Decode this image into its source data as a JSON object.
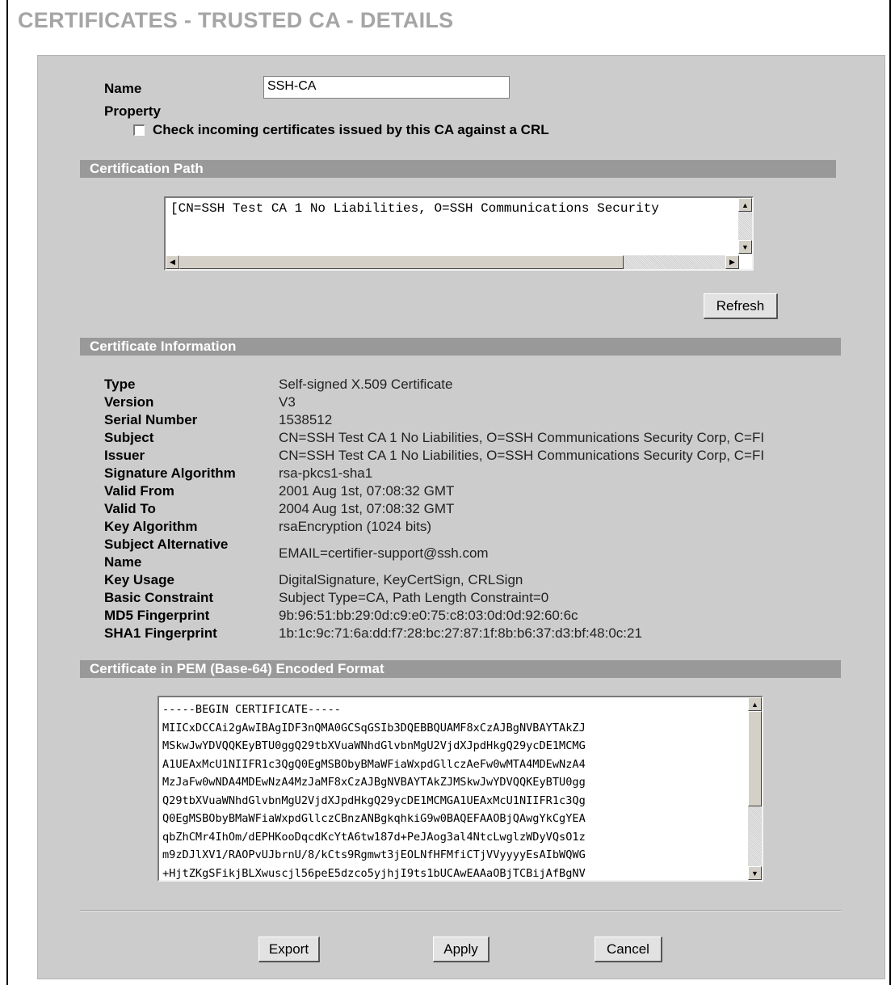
{
  "page_title": "CERTIFICATES - TRUSTED CA - DETAILS",
  "name_label": "Name",
  "name_value": "SSH-CA",
  "property_label": "Property",
  "crl_check_label": "Check incoming certificates issued by this CA against a CRL",
  "crl_checked": false,
  "cert_path": {
    "header": "Certification Path",
    "text": "[CN=SSH Test CA 1 No Liabilities, O=SSH Communications Security",
    "refresh_label": "Refresh"
  },
  "cert_info": {
    "header": "Certificate Information",
    "rows": [
      {
        "key": "Type",
        "value": "Self-signed X.509 Certificate"
      },
      {
        "key": "Version",
        "value": "V3"
      },
      {
        "key": "Serial Number",
        "value": "1538512"
      },
      {
        "key": "Subject",
        "value": "CN=SSH Test CA 1 No Liabilities, O=SSH Communications Security Corp, C=FI"
      },
      {
        "key": "Issuer",
        "value": "CN=SSH Test CA 1 No Liabilities, O=SSH Communications Security Corp, C=FI"
      },
      {
        "key": "Signature Algorithm",
        "value": "rsa-pkcs1-sha1"
      },
      {
        "key": "Valid From",
        "value": "2001 Aug 1st, 07:08:32 GMT"
      },
      {
        "key": "Valid To",
        "value": "2004 Aug 1st, 07:08:32 GMT"
      },
      {
        "key": "Key Algorithm",
        "value": "rsaEncryption (1024 bits)"
      },
      {
        "key": "Subject Alternative Name",
        "value": "EMAIL=certifier-support@ssh.com"
      },
      {
        "key": "Key Usage",
        "value": "DigitalSignature, KeyCertSign, CRLSign"
      },
      {
        "key": "Basic Constraint",
        "value": "Subject Type=CA, Path Length Constraint=0"
      },
      {
        "key": "MD5 Fingerprint",
        "value": "9b:96:51:bb:29:0d:c9:e0:75:c8:03:0d:0d:92:60:6c"
      },
      {
        "key": "SHA1 Fingerprint",
        "value": "1b:1c:9c:71:6a:dd:f7:28:bc:27:87:1f:8b:b6:37:d3:bf:48:0c:21"
      }
    ]
  },
  "pem": {
    "header": "Certificate in PEM (Base-64) Encoded Format",
    "lines": [
      "-----BEGIN CERTIFICATE-----",
      "MIICxDCCAi2gAwIBAgIDF3nQMA0GCSqGSIb3DQEBBQUAMF8xCzAJBgNVBAYTAkZJ",
      "MSkwJwYDVQQKEyBTU0ggQ29tbXVuaWNhdGlvbnMgU2VjdXJpdHkgQ29ycDE1MCMG",
      "A1UEAxMcU1NIIFR1c3QgQ0EgMSBObyBMaWFiaWxpdGllczAeFw0wMTA4MDEwNzA4",
      "MzJaFw0wNDA4MDEwNzA4MzJaMF8xCzAJBgNVBAYTAkZJMSkwJwYDVQQKEyBTU0gg",
      "Q29tbXVuaWNhdGlvbnMgU2VjdXJpdHkgQ29ycDE1MCMGA1UEAxMcU1NIIFR1c3Qg",
      "Q0EgMSBObyBMaWFiaWxpdGllczCBnzANBgkqhkiG9w0BAQEFAAOBjQAwgYkCgYEA",
      "qbZhCMr4IhOm/dEPHKooDqcdKcYtA6tw187d+PeJAog3al4NtcLwglzWDyVQsO1z",
      "m9zDJlXV1/RAOPvUJbrnU/8/kCts9Rgmwt3jEOLNfHFMfiCTjVVyyyyEsAIbWQWG",
      "+HjtZKgSFikjBLXwuscjl56peE5dzco5yjhjI9ts1bUCAwEAAaOBjTCBijAfBgNV"
    ]
  },
  "buttons": {
    "export": "Export",
    "apply": "Apply",
    "cancel": "Cancel"
  }
}
